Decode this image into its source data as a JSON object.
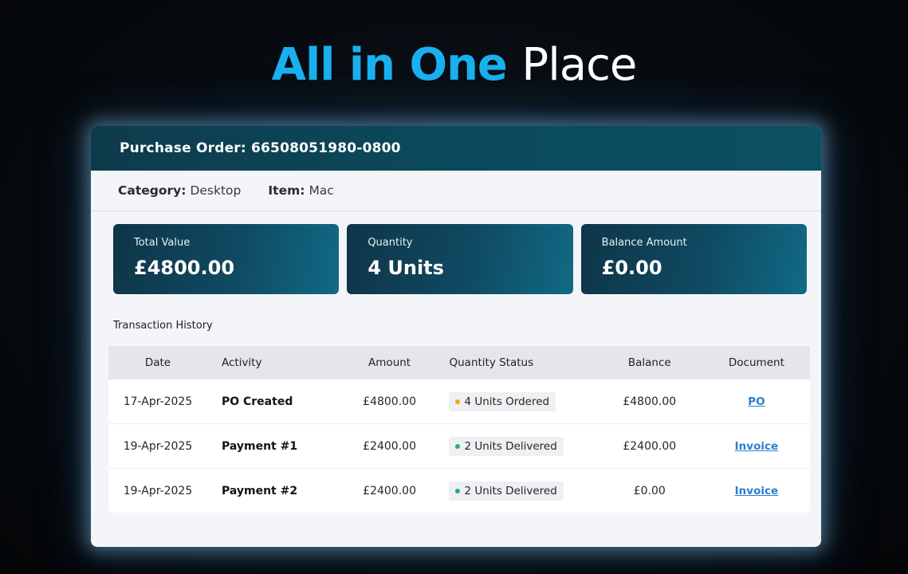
{
  "hero": {
    "accent_text": "All in One",
    "plain_text": "Place"
  },
  "order": {
    "title": "Purchase Order: 66508051980-0800",
    "category_label": "Category:",
    "category_value": "Desktop",
    "item_label": "Item:",
    "item_value": "Mac"
  },
  "stats": [
    {
      "label": "Total Value",
      "value": "£4800.00"
    },
    {
      "label": "Quantity",
      "value": "4 Units"
    },
    {
      "label": "Balance Amount",
      "value": "£0.00"
    }
  ],
  "transactions": {
    "title": "Transaction History",
    "columns": [
      "Date",
      "Activity",
      "Amount",
      "Quantity Status",
      "Balance",
      "Document"
    ],
    "rows": [
      {
        "date": "17-Apr-2025",
        "activity": "PO Created",
        "amount": "£4800.00",
        "status": "4 Units Ordered",
        "status_color": "#f2a81d",
        "balance": "£4800.00",
        "document": "PO"
      },
      {
        "date": "19-Apr-2025",
        "activity": "Payment #1",
        "amount": "£2400.00",
        "status": "2 Units Delivered",
        "status_color": "#22b07a",
        "balance": "£2400.00",
        "document": "Invoice"
      },
      {
        "date": "19-Apr-2025",
        "activity": "Payment #2",
        "amount": "£2400.00",
        "status": "2 Units Delivered",
        "status_color": "#22b07a",
        "balance": "£0.00",
        "document": "Invoice"
      }
    ]
  },
  "colors": {
    "accent": "#1ab0ee",
    "header_bg": "#0e3b4c",
    "link": "#2a7fd0"
  }
}
